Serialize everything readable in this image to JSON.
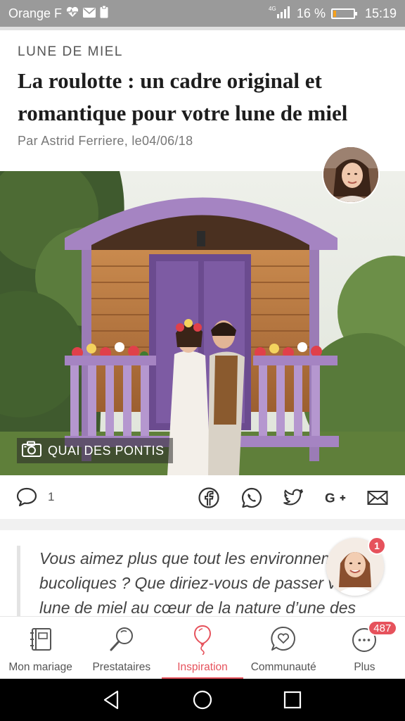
{
  "status_bar": {
    "carrier": "Orange F",
    "network": "4G",
    "battery_percent": "16 %",
    "time": "15:19",
    "battery_level": 0.16
  },
  "article": {
    "category": "LUNE DE MIEL",
    "title": "La roulotte : un cadre original et romantique pour votre lune de miel",
    "byline": "Par Astrid Ferriere, le04/06/18",
    "photo_credit": "QUAI DES PONTIS",
    "comment_count": "1",
    "excerpt_lines": [
      "Vous aimez plus que tout les environnements",
      "bucoliques ? Que diriez-vous de passer votre",
      "lune de miel au cœur de la nature d’une des"
    ]
  },
  "share_icons": [
    "facebook-icon",
    "whatsapp-icon",
    "twitter-icon",
    "google-plus-icon",
    "email-icon"
  ],
  "chat": {
    "badge": "1"
  },
  "bottom_nav": {
    "items": [
      {
        "label": "Mon mariage",
        "icon": "notebook-icon"
      },
      {
        "label": "Prestataires",
        "icon": "search-icon"
      },
      {
        "label": "Inspiration",
        "icon": "balloon-icon",
        "active": true
      },
      {
        "label": "Communauté",
        "icon": "heart-chat-icon"
      },
      {
        "label": "Plus",
        "icon": "more-icon",
        "badge": "487"
      }
    ]
  },
  "colors": {
    "accent": "#e6525c",
    "status_bar": "#9a9a9a",
    "wagon_purple": "#9b7cb6"
  }
}
